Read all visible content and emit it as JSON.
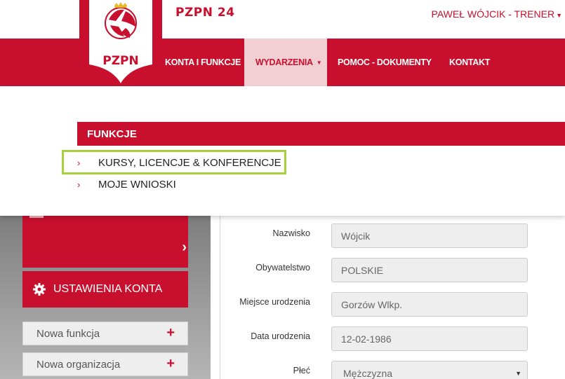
{
  "header": {
    "brand_title": "PZPN 24",
    "logo_text": "PZPN",
    "user_label": "PAWEŁ WÓJCIK - TRENER"
  },
  "nav": {
    "items": [
      {
        "label": "KONTA I FUNKCJE"
      },
      {
        "label": "WYDARZENIA"
      },
      {
        "label": "POMOC - DOKUMENTY"
      },
      {
        "label": "KONTAKT"
      }
    ]
  },
  "dropdown": {
    "header": "FUNKCJE",
    "items": [
      {
        "label": "KURSY, LICENCJE & KONFERENCJE"
      },
      {
        "label": "MOJE WNIOSKI"
      }
    ]
  },
  "sidebar": {
    "settings_label": "USTAWIENIA KONTA",
    "buttons": [
      {
        "label": "Nowa funkcja"
      },
      {
        "label": "Nowa organizacja"
      }
    ]
  },
  "form": {
    "fields": [
      {
        "label": "Nazwisko",
        "value": "Wójcik"
      },
      {
        "label": "Obywatelstwo",
        "value": "POLSKIE"
      },
      {
        "label": "Miejsce urodzenia",
        "value": "Gorzów Wlkp."
      },
      {
        "label": "Data urodzenia",
        "value": "12-02-1986"
      },
      {
        "label": "Płeć",
        "value": "Mężczyzna"
      }
    ]
  },
  "colors": {
    "brand_red": "#c8102e",
    "highlight_green": "#a6d13b",
    "active_nav_bg": "#f2cfd3"
  }
}
